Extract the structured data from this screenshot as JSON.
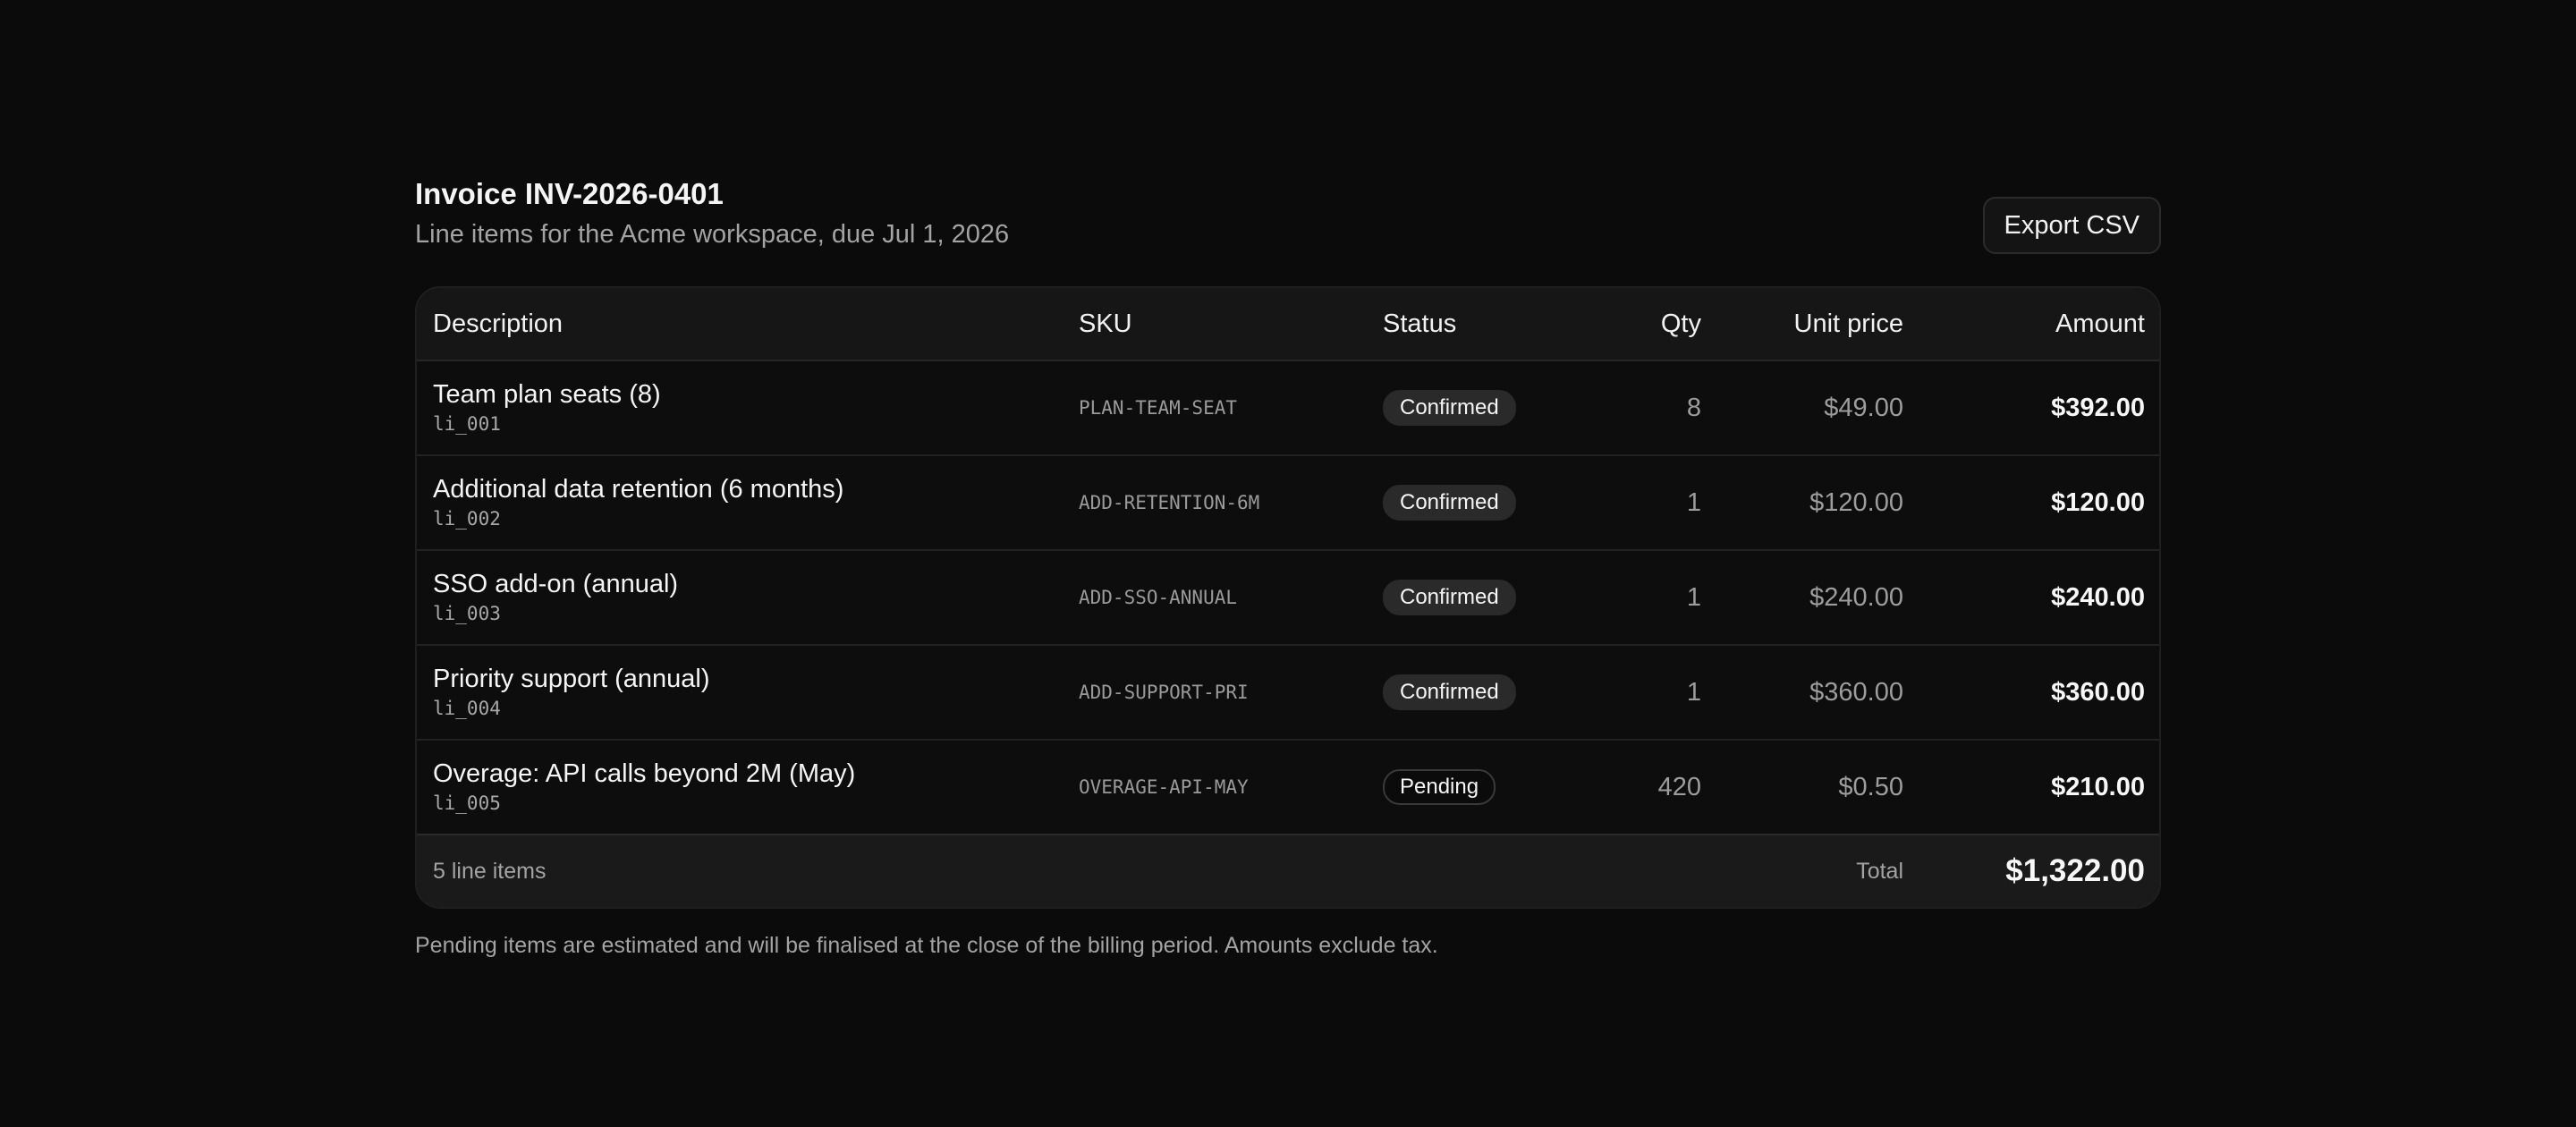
{
  "invoice": {
    "title": "Invoice INV-2026-0401",
    "subtitle": "Line items for the Acme workspace, due Jul 1, 2026",
    "export_label": "Export CSV"
  },
  "table": {
    "columns": {
      "description": "Description",
      "sku": "SKU",
      "status": "Status",
      "qty": "Qty",
      "unit_price": "Unit price",
      "amount": "Amount"
    },
    "rows": [
      {
        "description": "Team plan seats (8)",
        "id": "li_001",
        "sku": "PLAN-TEAM-SEAT",
        "status": "Confirmed",
        "qty": "8",
        "unit_price": "$49.00",
        "amount": "$392.00"
      },
      {
        "description": "Additional data retention (6 months)",
        "id": "li_002",
        "sku": "ADD-RETENTION-6M",
        "status": "Confirmed",
        "qty": "1",
        "unit_price": "$120.00",
        "amount": "$120.00"
      },
      {
        "description": "SSO add-on (annual)",
        "id": "li_003",
        "sku": "ADD-SSO-ANNUAL",
        "status": "Confirmed",
        "qty": "1",
        "unit_price": "$240.00",
        "amount": "$240.00"
      },
      {
        "description": "Priority support (annual)",
        "id": "li_004",
        "sku": "ADD-SUPPORT-PRI",
        "status": "Confirmed",
        "qty": "1",
        "unit_price": "$360.00",
        "amount": "$360.00"
      },
      {
        "description": "Overage: API calls beyond 2M (May)",
        "id": "li_005",
        "sku": "OVERAGE-API-MAY",
        "status": "Pending",
        "qty": "420",
        "unit_price": "$0.50",
        "amount": "$210.00"
      }
    ],
    "footer": {
      "count": "5 line items",
      "total_label": "Total",
      "total_value": "$1,322.00"
    }
  },
  "note": "Pending items are estimated and will be finalised at the close of the billing period. Amounts exclude tax.",
  "colors": {
    "background": "#0b0b0b",
    "badge_confirmed": "#2a2a2a",
    "badge_pending_border": "#3a3a3a"
  }
}
